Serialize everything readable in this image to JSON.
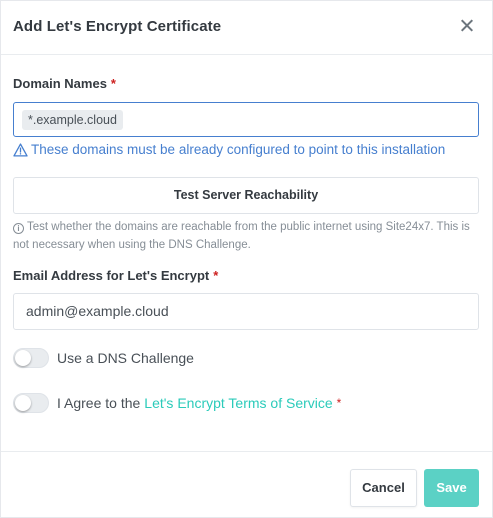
{
  "modal": {
    "title": "Add Let's Encrypt Certificate",
    "close_icon": "close-icon"
  },
  "domains": {
    "label": "Domain Names",
    "required_mark": "*",
    "tags": [
      "*.example.cloud"
    ],
    "warning_icon": "warning-triangle-icon",
    "warning": "These domains must be already configured to point to this installation"
  },
  "reachability": {
    "button_label": "Test Server Reachability",
    "info_icon": "info-circle-icon",
    "info_glyph": "i",
    "help_text": "Test whether the domains are reachable from the public internet using Site24x7. This is not necessary when using the DNS Challenge."
  },
  "email": {
    "label": "Email Address for Let's Encrypt",
    "required_mark": "*",
    "value": "admin@example.cloud"
  },
  "dns_challenge": {
    "label": "Use a DNS Challenge",
    "enabled": false
  },
  "agree": {
    "prefix": "I Agree to the",
    "link_text": "Let's Encrypt Terms of Service",
    "required_mark": "*",
    "enabled": false
  },
  "footer": {
    "cancel_label": "Cancel",
    "save_label": "Save"
  },
  "colors": {
    "accent_blue": "#467fcf",
    "teal": "#2bcbba",
    "save_button": "#5bd1c5",
    "required": "#cd201f"
  }
}
